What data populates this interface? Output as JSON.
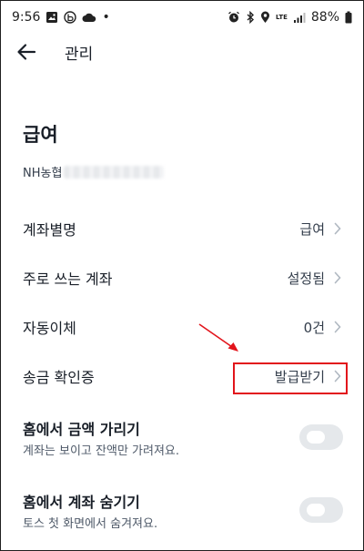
{
  "status_bar": {
    "time": "9:56",
    "dot": "•",
    "battery": "88%",
    "network_label": "LTE",
    "left_icons": [
      "image-icon",
      "app-b-icon",
      "cloud-icon"
    ],
    "right_icons": [
      "alarm-icon",
      "bluetooth-icon",
      "location-icon",
      "signal-icon",
      "battery-icon"
    ]
  },
  "header": {
    "title": "관리"
  },
  "account": {
    "name": "급여",
    "bank_prefix": "NH농협"
  },
  "rows": [
    {
      "label": "계좌별명",
      "value": "급여"
    },
    {
      "label": "주로 쓰는 계좌",
      "value": "설정됨"
    },
    {
      "label": "자동이체",
      "value": "0건"
    },
    {
      "label": "송금 확인증",
      "value": "발급받기"
    }
  ],
  "toggles": [
    {
      "title": "홈에서 금액 가리기",
      "description": "계좌는 보이고 잔액만 가려져요.",
      "on": false
    },
    {
      "title": "홈에서 계좌 숨기기",
      "description": "토스 첫 화면에서 숨겨져요.",
      "on": false
    }
  ],
  "colors": {
    "annotation": "#e2141b",
    "toggle_off": "#e5e8eb",
    "text_primary": "#191f28",
    "text_secondary": "#4e5968"
  }
}
